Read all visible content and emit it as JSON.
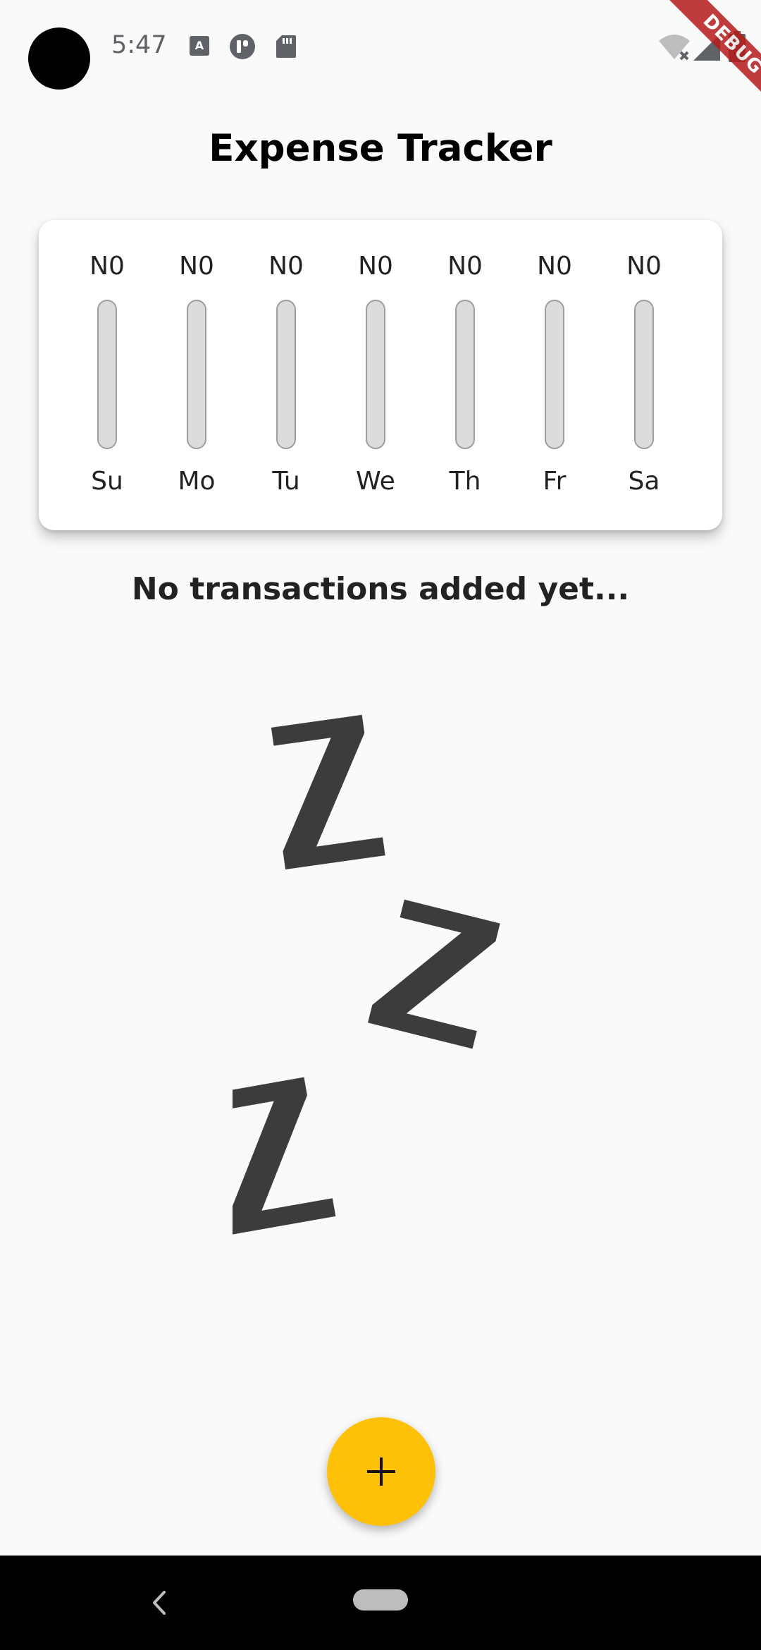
{
  "status_bar": {
    "time": "5:47",
    "icons": [
      "keyboard-a-icon",
      "app-badge-icon",
      "sd-card-icon",
      "wifi-off-icon",
      "signal-icon",
      "battery-icon"
    ]
  },
  "debug_banner": "DEBUG",
  "app": {
    "title": "Expense Tracker"
  },
  "chart": {
    "days": [
      {
        "label": "Su",
        "amount": "N0",
        "fraction": 0
      },
      {
        "label": "Mo",
        "amount": "N0",
        "fraction": 0
      },
      {
        "label": "Tu",
        "amount": "N0",
        "fraction": 0
      },
      {
        "label": "We",
        "amount": "N0",
        "fraction": 0
      },
      {
        "label": "Th",
        "amount": "N0",
        "fraction": 0
      },
      {
        "label": "Fr",
        "amount": "N0",
        "fraction": 0
      },
      {
        "label": "Sa",
        "amount": "N0",
        "fraction": 0
      }
    ],
    "colors": {
      "bar_track": "#dcdcdc",
      "bar_border": "#9e9e9e",
      "bar_fill": "#ffc107"
    }
  },
  "empty_state": {
    "message": "No transactions added yet...",
    "image_icon": "sleeping-zzz-icon"
  },
  "fab": {
    "icon": "plus-icon",
    "color": "#ffc107"
  },
  "nav_bar": {
    "icons": [
      "back-icon",
      "home-pill-icon"
    ]
  }
}
